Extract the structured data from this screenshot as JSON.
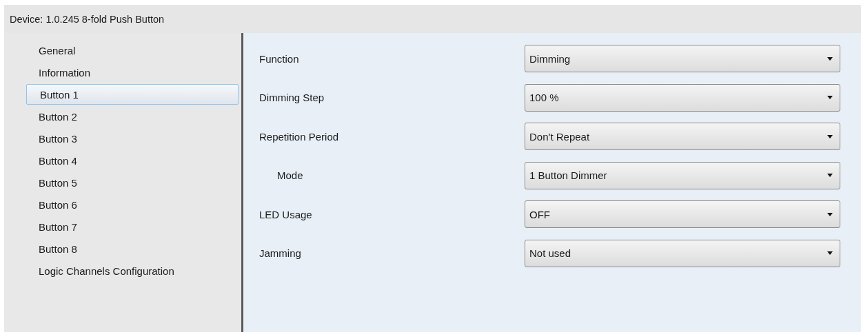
{
  "header": {
    "title": "Device: 1.0.245  8-fold Push Button"
  },
  "sidebar": {
    "items": [
      {
        "label": "General",
        "selected": false
      },
      {
        "label": "Information",
        "selected": false
      },
      {
        "label": "Button 1",
        "selected": true
      },
      {
        "label": "Button 2",
        "selected": false
      },
      {
        "label": "Button 3",
        "selected": false
      },
      {
        "label": "Button 4",
        "selected": false
      },
      {
        "label": "Button 5",
        "selected": false
      },
      {
        "label": "Button 6",
        "selected": false
      },
      {
        "label": "Button 7",
        "selected": false
      },
      {
        "label": "Button 8",
        "selected": false
      },
      {
        "label": "Logic Channels Configuration",
        "selected": false
      }
    ]
  },
  "parameters": [
    {
      "label": "Function",
      "value": "Dimming"
    },
    {
      "label": "Dimming Step",
      "value": "100 %"
    },
    {
      "label": "Repetition Period",
      "value": "Don't Repeat",
      "children": [
        {
          "label": "Mode",
          "value": "1 Button Dimmer"
        }
      ]
    },
    {
      "label": "LED Usage",
      "value": "OFF"
    },
    {
      "label": "Jamming",
      "value": "Not used"
    }
  ]
}
